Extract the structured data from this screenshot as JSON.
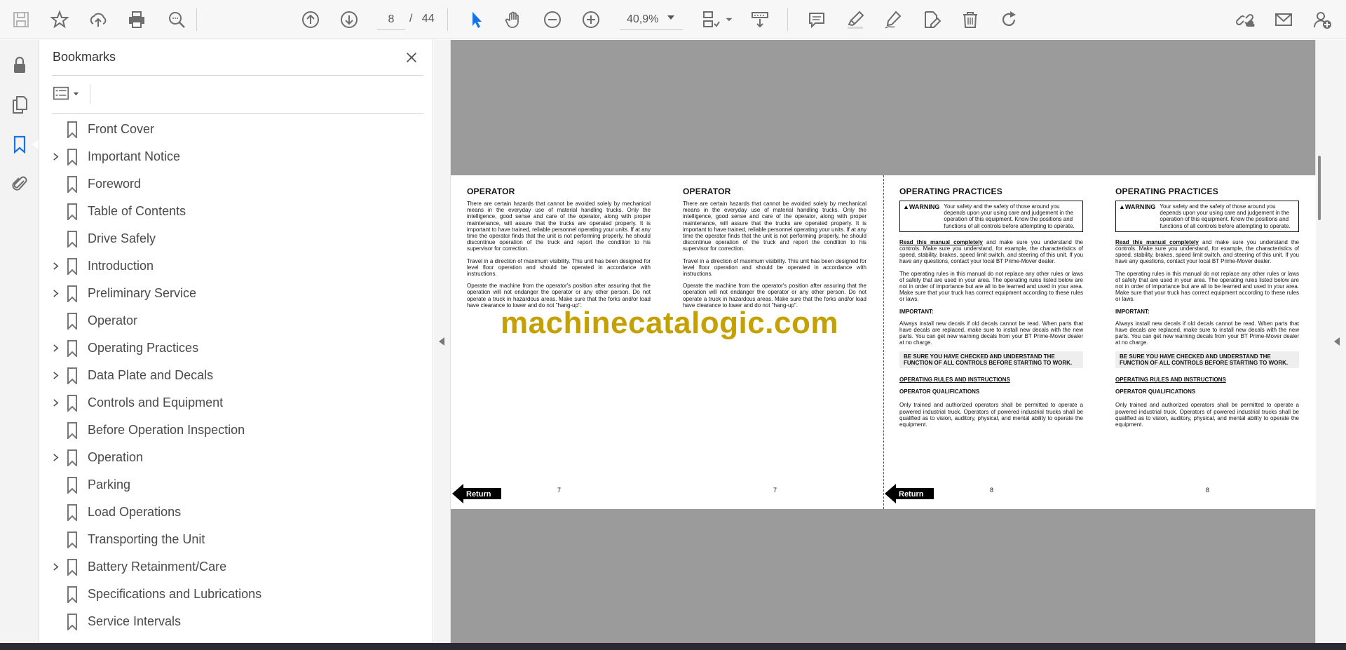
{
  "toolbar": {
    "page_current": "8",
    "page_separator": "/",
    "page_total": "44",
    "zoom": "40,9%",
    "icons": [
      "save-icon",
      "star-icon",
      "upload-icon",
      "print-icon",
      "find-icon",
      "page-up-icon",
      "page-down-icon",
      "select-cursor-icon",
      "hand-icon",
      "zoom-out-icon",
      "zoom-in-icon",
      "page-layout-icon",
      "scroll-mode-icon",
      "comment-icon",
      "highlight-icon",
      "sign-icon",
      "edit-pdf-icon",
      "delete-icon",
      "redo-icon",
      "share-link-icon",
      "email-icon",
      "add-user-icon"
    ]
  },
  "rail": {
    "icons": [
      "lock-icon",
      "pages-icon",
      "bookmark-icon",
      "attachment-icon"
    ]
  },
  "bookmarks": {
    "title": "Bookmarks",
    "items": [
      {
        "label": "Front Cover",
        "expandable": false
      },
      {
        "label": "Important Notice",
        "expandable": true
      },
      {
        "label": "Foreword",
        "expandable": false
      },
      {
        "label": "Table of Contents",
        "expandable": false
      },
      {
        "label": "Drive Safely",
        "expandable": false
      },
      {
        "label": "Introduction",
        "expandable": true
      },
      {
        "label": "Preliminary Service",
        "expandable": true
      },
      {
        "label": "Operator",
        "expandable": false
      },
      {
        "label": "Operating Practices",
        "expandable": true
      },
      {
        "label": "Data Plate and Decals",
        "expandable": true
      },
      {
        "label": "Controls and Equipment",
        "expandable": true
      },
      {
        "label": "Before Operation Inspection",
        "expandable": false
      },
      {
        "label": "Operation",
        "expandable": true
      },
      {
        "label": "Parking",
        "expandable": false
      },
      {
        "label": "Load Operations",
        "expandable": false
      },
      {
        "label": "Transporting the Unit",
        "expandable": false
      },
      {
        "label": "Battery Retainment/Care",
        "expandable": true
      },
      {
        "label": "Specifications and Lubrications",
        "expandable": false
      },
      {
        "label": "Service Intervals",
        "expandable": false
      }
    ]
  },
  "document": {
    "operator": {
      "heading": "OPERATOR",
      "p1": "There are certain hazards that cannot be avoided solely by mechanical means in the everyday use of material handling trucks. Only the intelligence, good sense and care of the operator, along with proper maintenance, will assure that the trucks are operated properly. It is important to have trained, reliable personnel operating your units. If at any time the operator finds that the unit is not performing properly, he should discontinue operation of the truck and report the condition to his supervisor for correction.",
      "p2": "Travel in a direction of maximum visibility. This unit has been designed for level floor operation and should be operated in accordance with instructions.",
      "p3": "Operate the machine from the operator's position after assuring that the operation will not endanger the operator or any other person. Do not operate a truck in hazardous areas. Make sure that the forks and/or load have clearance to lower and do not \"hang-up\".",
      "page_number": "7"
    },
    "practices": {
      "heading": "OPERATING PRACTICES",
      "warning_label": "WARNING",
      "warning_text": "Your safety and the safety of those around you depends upon your using care and judgement in the operation of this equipment. Know the positions and functions of all controls before attempting to operate.",
      "p1_lead": "Read this manual completely",
      "p1_rest": " and make sure you understand the controls. Make sure you understand, for example, the characteristics of speed, stability, brakes, speed limit switch, and steering of this unit. If you have any questions, contact your local BT Prime-Mover dealer.",
      "p2": "The operating rules in this manual do not replace any other rules or laws of safety that are used in your area. The operating rules listed below are not in order of importance but are all to be learned and used in your area. Make sure that your truck has correct equipment according to these rules or laws.",
      "important": "IMPORTANT:",
      "p3": "Always install new decals if old decals cannot be read. When parts that have decals are replaced, make sure to install new decals with the new parts. You can get new warning decals from your BT Prime-Mover dealer at no charge.",
      "callout": "BE SURE YOU HAVE CHECKED AND UNDERSTAND THE FUNCTION OF ALL CONTROLS BEFORE STARTING TO WORK.",
      "rules_heading": "OPERATING RULES AND INSTRUCTIONS",
      "qual_heading": "OPERATOR QUALIFICATIONS",
      "p4": "Only trained and authorized operators shall be permitted to operate a powered industrial truck. Operators of powered industrial trucks shall be qualified as to vision, auditory, physical, and mental ability to operate the equipment.",
      "page_number": "8"
    },
    "return_label": "Return",
    "watermark": "machinecatalogic.com"
  },
  "colors": {
    "accent_blue": "#1473e6",
    "icon_gray": "#6e6e6e",
    "doc_background": "#9b9b9b",
    "watermark": "#c4a000"
  }
}
